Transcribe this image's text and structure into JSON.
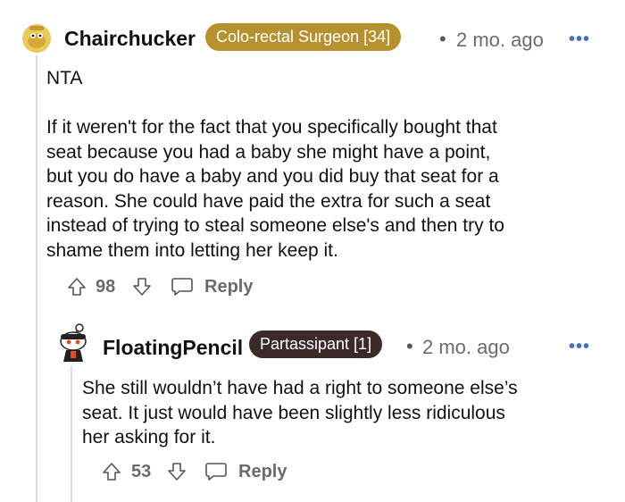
{
  "comment1": {
    "username": "Chairchucker",
    "flair": "Colo-rectal Surgeon [34]",
    "separator": "•",
    "time": "2 mo. ago",
    "more": "•••",
    "lines": [
      "NTA",
      "If it weren't for the fact that you specifically bought that",
      "seat because you had a baby she might have a point,",
      "but you do have a baby and you did buy that seat for a",
      "reason. She could have paid the extra for such a seat",
      "instead of trying to steal someone else's and then try to",
      "shame them into letting her keep it."
    ],
    "votes": "98",
    "reply": "Reply"
  },
  "comment2": {
    "username": "FloatingPencil",
    "flair": "Partassipant [1]",
    "separator": "•",
    "time": "2 mo. ago",
    "more": "•••",
    "lines": [
      "She still wouldn’t have had a right to someone else’s",
      "seat. It just would have been slightly less ridiculous",
      "her asking for it."
    ],
    "votes": "53",
    "reply": "Reply"
  },
  "colors": {
    "flair1": "#b8912f",
    "flair2": "#3b2a27",
    "thread_line": "#dcdcdc",
    "more": "#4a6fb5"
  },
  "icons": [
    "upvote-icon",
    "downvote-icon",
    "comment-bubble-icon",
    "more-icon"
  ]
}
